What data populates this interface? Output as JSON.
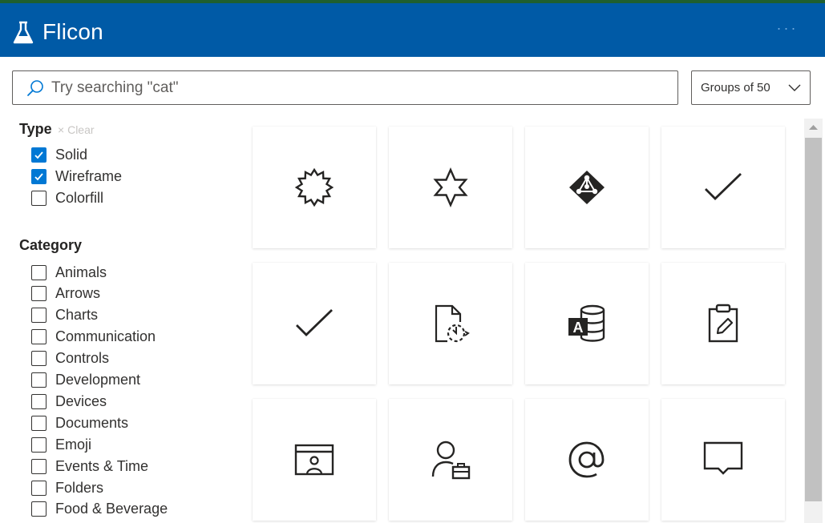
{
  "app": {
    "title": "Flicon"
  },
  "header": {
    "more_label": "···"
  },
  "search": {
    "placeholder": "Try searching \"cat\"",
    "value": ""
  },
  "groups_dropdown": {
    "selected": "Groups of 50"
  },
  "filters": {
    "type_title": "Type",
    "clear_label": "Clear",
    "type_options": [
      {
        "label": "Solid",
        "checked": true
      },
      {
        "label": "Wireframe",
        "checked": true
      },
      {
        "label": "Colorfill",
        "checked": false
      }
    ],
    "category_title": "Category",
    "category_options": [
      {
        "label": "Animals",
        "checked": false
      },
      {
        "label": "Arrows",
        "checked": false
      },
      {
        "label": "Charts",
        "checked": false
      },
      {
        "label": "Communication",
        "checked": false
      },
      {
        "label": "Controls",
        "checked": false
      },
      {
        "label": "Development",
        "checked": false
      },
      {
        "label": "Devices",
        "checked": false
      },
      {
        "label": "Documents",
        "checked": false
      },
      {
        "label": "Emoji",
        "checked": false
      },
      {
        "label": "Events & Time",
        "checked": false
      },
      {
        "label": "Folders",
        "checked": false
      },
      {
        "label": "Food & Beverage",
        "checked": false
      }
    ]
  },
  "icons": [
    "badge-starburst-icon",
    "six-point-star-icon",
    "azure-ad-icon",
    "checkmark-icon",
    "checkmark-icon",
    "document-sync-icon",
    "access-database-icon",
    "clipboard-edit-icon",
    "contact-card-icon",
    "user-briefcase-icon",
    "at-sign-icon",
    "comment-icon"
  ],
  "colors": {
    "header": "#005aa6",
    "accent": "#0078d4",
    "icon": "#252423"
  }
}
